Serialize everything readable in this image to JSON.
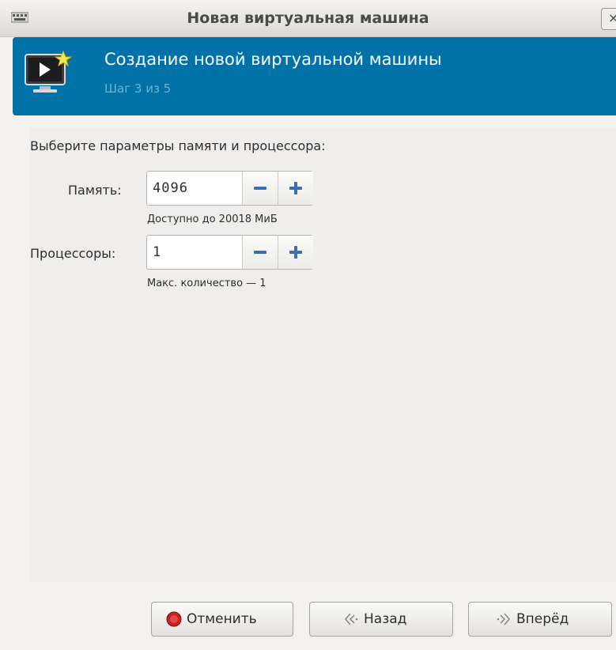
{
  "window": {
    "title": "Новая виртуальная машина",
    "close_glyph": "×"
  },
  "header": {
    "title": "Создание новой виртуальной машины",
    "step": "Шаг 3 из 5",
    "icon": "vm-monitor-new-icon",
    "accent_color": "#0072a8"
  },
  "form": {
    "prompt": "Выберите параметры памяти и процессора:",
    "memory": {
      "label": "Память:",
      "value": "4096",
      "hint": "Доступно до 20018 МиБ"
    },
    "cpus": {
      "label": "Процессоры:",
      "value": "1",
      "hint": "Макс. количество — 1"
    }
  },
  "footer": {
    "cancel_label": "Отменить",
    "back_label": "Назад",
    "forward_label": "Вперёд"
  },
  "icons": {
    "cancel": "stop-icon",
    "back": "back-arrow-icon",
    "forward": "forward-arrow-icon",
    "decrement": "minus-icon",
    "increment": "plus-icon"
  }
}
